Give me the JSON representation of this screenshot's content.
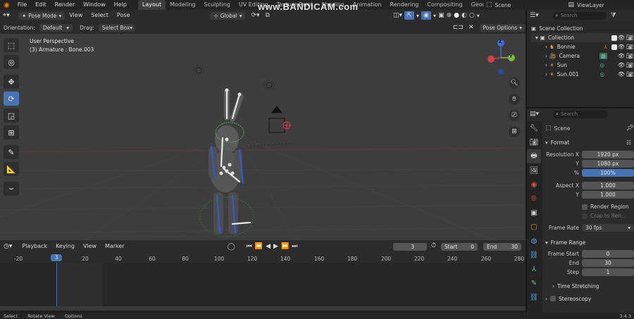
{
  "topbar": {
    "menus": [
      "File",
      "Edit",
      "Render",
      "Window",
      "Help"
    ],
    "workspaces": [
      "Layout",
      "Modeling",
      "Sculpting",
      "UV Editing",
      "Texture Paint",
      "Shading",
      "Animation",
      "Rendering",
      "Compositing",
      "Geometry Node"
    ],
    "active_workspace": "Layout",
    "scene_label": "Scene",
    "view_layer_label": "ViewLayer"
  },
  "watermark": "www.BANDICAM.com",
  "viewport_header": {
    "mode": "Pose Mode",
    "menus": [
      "View",
      "Select",
      "Pose"
    ],
    "transform_orientation": "Global",
    "orientation_label": "Orientation:",
    "orientation_value": "Default",
    "drag_label": "Drag:",
    "drag_value": "Select Box",
    "pose_options": "Pose Options"
  },
  "viewport": {
    "perspective": "User Perspective",
    "active_object": "(3) Armature : Bone.003",
    "gizmo": {
      "z": "Z",
      "y": "Y",
      "x": "X"
    }
  },
  "outliner": {
    "search_placeholder": "Search",
    "root": "Scene Collection",
    "collection": "Collection",
    "items": [
      {
        "name": "Bonnie",
        "icon": "armature-icon"
      },
      {
        "name": "Camera",
        "icon": "camera-icon"
      },
      {
        "name": "Sun",
        "icon": "light-icon"
      },
      {
        "name": "Sun.001",
        "icon": "light-icon"
      }
    ]
  },
  "properties": {
    "search_placeholder": "Search",
    "context": "Scene",
    "format": {
      "title": "Format",
      "resolution_label": "Resolution X",
      "res_x": "1920 px",
      "res_y_label": "Y",
      "res_y": "1080 px",
      "pct_label": "%",
      "pct": "100%",
      "aspect_label": "Aspect X",
      "aspect_x": "1.000",
      "aspect_y_label": "Y",
      "aspect_y": "1.000",
      "render_region": "Render Region",
      "crop": "Crop to Ren...",
      "frame_rate_label": "Frame Rate",
      "frame_rate": "30 fps"
    },
    "frame_range": {
      "title": "Frame Range",
      "start_label": "Frame Start",
      "start": "0",
      "end_label": "End",
      "end": "30",
      "step_label": "Step",
      "step": "1"
    },
    "time_stretching": "Time Stretching",
    "stereoscopy": "Stereoscopy"
  },
  "timeline": {
    "menus": [
      "Playback",
      "Keying",
      "View",
      "Marker"
    ],
    "current_frame": "3",
    "start_label": "Start",
    "start": "0",
    "end_label": "End",
    "end": "30",
    "ticks": [
      "-20",
      "20",
      "40",
      "60",
      "80",
      "100",
      "120",
      "140",
      "160",
      "180",
      "200",
      "220",
      "240",
      "260",
      "280"
    ],
    "playhead": "3"
  },
  "statusbar": {
    "items": [
      "Select",
      "Rotate View",
      "Options"
    ],
    "version": "3.4.3"
  }
}
